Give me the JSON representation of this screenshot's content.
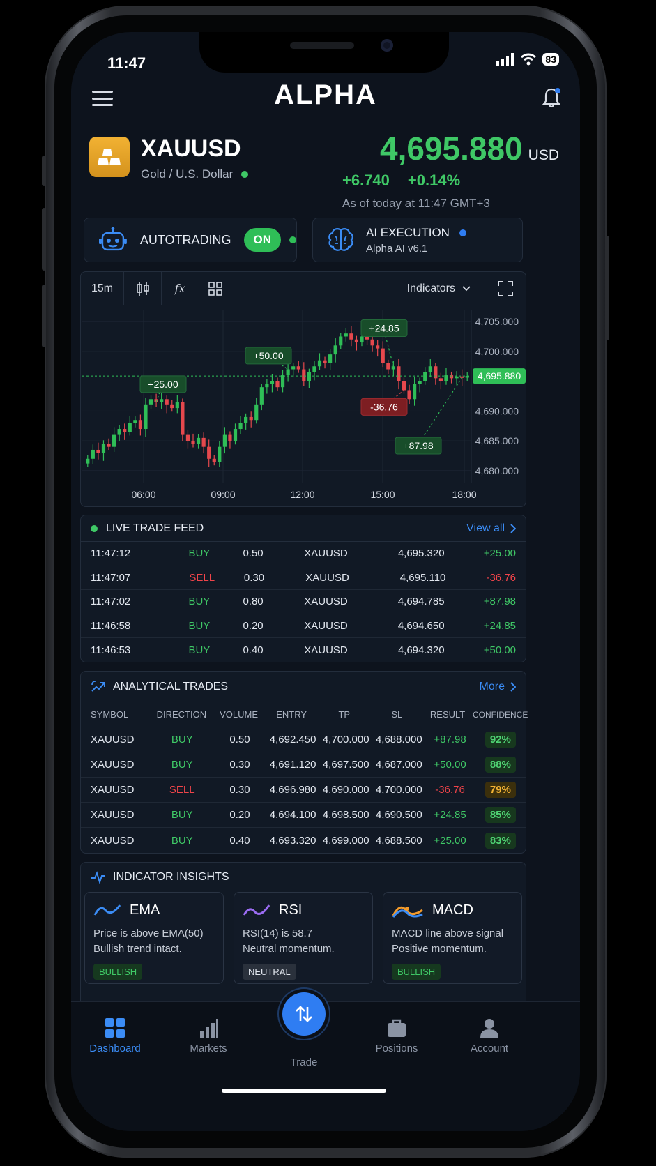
{
  "status": {
    "time": "11:47",
    "battery": "83"
  },
  "header": {
    "logo": "ALPHA"
  },
  "asset": {
    "symbol": "XAUUSD",
    "name": "Gold / U.S. Dollar",
    "price": "4,695.880",
    "currency": "USD",
    "change_abs": "+6.740",
    "change_pct": "+0.14%",
    "as_of": "As of today at 11:47 GMT+3"
  },
  "autotrading": {
    "label": "AUTOTRADING",
    "state": "ON"
  },
  "ai_execution": {
    "label": "AI EXECUTION",
    "version": "Alpha AI v6.1"
  },
  "chart_toolbar": {
    "timeframe": "15m",
    "fx": "fx",
    "indicators": "Indicators"
  },
  "chart_data": {
    "type": "candlestick",
    "x_ticks": [
      "06:00",
      "09:00",
      "12:00",
      "15:00",
      "18:00"
    ],
    "y_ticks": [
      "4,705.000",
      "4,700.000",
      "4,690.000",
      "4,685.000",
      "4,680.000"
    ],
    "current_price_label": "4,695.880",
    "ylim": [
      4678,
      4707
    ],
    "close": [
      4682.0,
      4683.5,
      4683.0,
      4684.5,
      4684.0,
      4686.0,
      4687.0,
      4686.5,
      4688.0,
      4688.5,
      4687.0,
      4691.0,
      4692.0,
      4691.5,
      4692.0,
      4691.0,
      4690.5,
      4691.5,
      4686.0,
      4685.0,
      4684.5,
      4685.5,
      4684.0,
      4682.0,
      4681.5,
      4684.0,
      4686.0,
      4685.0,
      4687.0,
      4688.0,
      4689.0,
      4688.5,
      4691.0,
      4694.0,
      4694.5,
      4695.0,
      4694.0,
      4696.0,
      4697.0,
      4697.5,
      4697.0,
      4695.0,
      4696.5,
      4697.5,
      4698.5,
      4698.0,
      4699.5,
      4701.0,
      4702.5,
      4703.0,
      4702.0,
      4701.5,
      4702.5,
      4702.0,
      4701.0,
      4700.5,
      4698.0,
      4697.0,
      4697.5,
      4695.0,
      4693.5,
      4692.0,
      4694.5,
      4695.0,
      4696.5,
      4697.5,
      4695.5,
      4695.0,
      4696.0,
      4695.5,
      4695.8,
      4695.6,
      4695.88
    ],
    "annotations": [
      {
        "label": "+25.00",
        "kind": "profit"
      },
      {
        "label": "+50.00",
        "kind": "profit"
      },
      {
        "label": "+24.85",
        "kind": "profit"
      },
      {
        "label": "-36.76",
        "kind": "loss"
      },
      {
        "label": "+87.98",
        "kind": "profit"
      }
    ]
  },
  "live_feed": {
    "title": "LIVE TRADE FEED",
    "view_all": "View all",
    "rows": [
      {
        "time": "11:47:12",
        "side": "BUY",
        "volume": "0.50",
        "symbol": "XAUUSD",
        "price": "4,695.320",
        "pl": "+25.00"
      },
      {
        "time": "11:47:07",
        "side": "SELL",
        "volume": "0.30",
        "symbol": "XAUUSD",
        "price": "4,695.110",
        "pl": "-36.76"
      },
      {
        "time": "11:47:02",
        "side": "BUY",
        "volume": "0.80",
        "symbol": "XAUUSD",
        "price": "4,694.785",
        "pl": "+87.98"
      },
      {
        "time": "11:46:58",
        "side": "BUY",
        "volume": "0.20",
        "symbol": "XAUUSD",
        "price": "4,694.650",
        "pl": "+24.85"
      },
      {
        "time": "11:46:53",
        "side": "BUY",
        "volume": "0.40",
        "symbol": "XAUUSD",
        "price": "4,694.320",
        "pl": "+50.00"
      }
    ]
  },
  "analytical": {
    "title": "ANALYTICAL TRADES",
    "more": "More",
    "headers": [
      "SYMBOL",
      "DIRECTION",
      "VOLUME",
      "ENTRY",
      "TP",
      "SL",
      "RESULT",
      "CONFIDENCE"
    ],
    "rows": [
      {
        "symbol": "XAUUSD",
        "direction": "BUY",
        "volume": "0.50",
        "entry": "4,692.450",
        "tp": "4,700.000",
        "sl": "4,688.000",
        "result": "+87.98",
        "confidence": "92%"
      },
      {
        "symbol": "XAUUSD",
        "direction": "BUY",
        "volume": "0.30",
        "entry": "4,691.120",
        "tp": "4,697.500",
        "sl": "4,687.000",
        "result": "+50.00",
        "confidence": "88%"
      },
      {
        "symbol": "XAUUSD",
        "direction": "SELL",
        "volume": "0.30",
        "entry": "4,696.980",
        "tp": "4,690.000",
        "sl": "4,700.000",
        "result": "-36.76",
        "confidence": "79%"
      },
      {
        "symbol": "XAUUSD",
        "direction": "BUY",
        "volume": "0.20",
        "entry": "4,694.100",
        "tp": "4,698.500",
        "sl": "4,690.500",
        "result": "+24.85",
        "confidence": "85%"
      },
      {
        "symbol": "XAUUSD",
        "direction": "BUY",
        "volume": "0.40",
        "entry": "4,693.320",
        "tp": "4,699.000",
        "sl": "4,688.500",
        "result": "+25.00",
        "confidence": "83%"
      }
    ]
  },
  "insights": {
    "title": "INDICATOR INSIGHTS",
    "cards": [
      {
        "name": "EMA",
        "line1": "Price is above EMA(50)",
        "line2": "Bullish trend intact.",
        "badge": "BULLISH"
      },
      {
        "name": "RSI",
        "line1": "RSI(14) is 58.7",
        "line2": "Neutral momentum.",
        "badge": "NEUTRAL"
      },
      {
        "name": "MACD",
        "line1": "MACD line above signal",
        "line2": "Positive momentum.",
        "badge": "BULLISH"
      }
    ]
  },
  "tabs": {
    "dashboard": "Dashboard",
    "markets": "Markets",
    "trade": "Trade",
    "positions": "Positions",
    "account": "Account"
  },
  "colors": {
    "accent": "#2f7df2",
    "up": "#3fc866",
    "down": "#f0444a",
    "gold": "#f2b233"
  }
}
